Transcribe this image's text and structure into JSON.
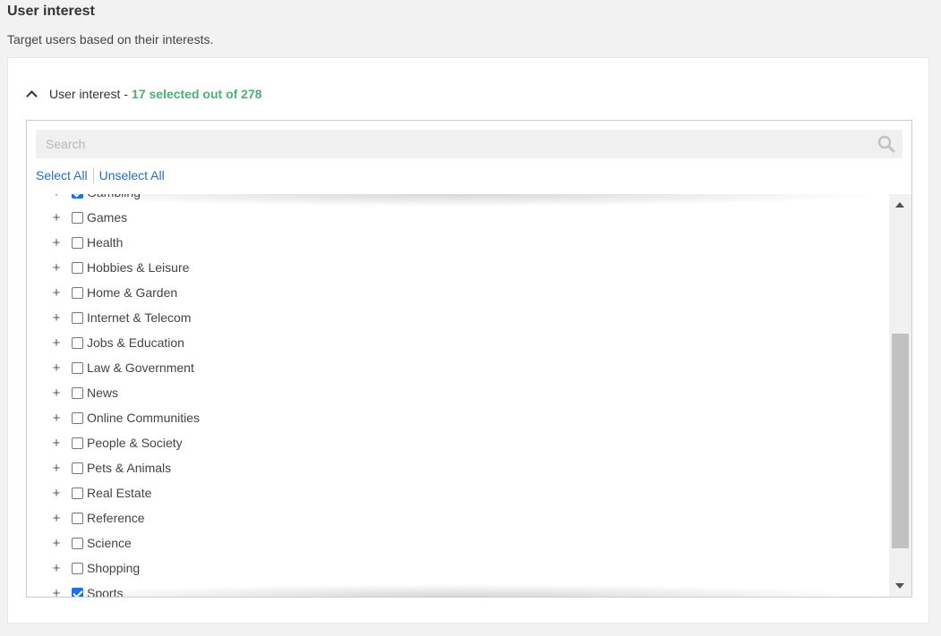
{
  "page": {
    "title": "User interest",
    "subtitle": "Target users based on their interests."
  },
  "section": {
    "label": "User interest",
    "separator": "-",
    "summary": "17 selected out of 278"
  },
  "search": {
    "placeholder": "Search",
    "value": ""
  },
  "actions": {
    "select_all": "Select All",
    "unselect_all": "Unselect All"
  },
  "interests": [
    {
      "label": "Gambling",
      "checked": true
    },
    {
      "label": "Games",
      "checked": false
    },
    {
      "label": "Health",
      "checked": false
    },
    {
      "label": "Hobbies & Leisure",
      "checked": false
    },
    {
      "label": "Home & Garden",
      "checked": false
    },
    {
      "label": "Internet & Telecom",
      "checked": false
    },
    {
      "label": "Jobs & Education",
      "checked": false
    },
    {
      "label": "Law & Government",
      "checked": false
    },
    {
      "label": "News",
      "checked": false
    },
    {
      "label": "Online Communities",
      "checked": false
    },
    {
      "label": "People & Society",
      "checked": false
    },
    {
      "label": "Pets & Animals",
      "checked": false
    },
    {
      "label": "Real Estate",
      "checked": false
    },
    {
      "label": "Reference",
      "checked": false
    },
    {
      "label": "Science",
      "checked": false
    },
    {
      "label": "Shopping",
      "checked": false
    },
    {
      "label": "Sports",
      "checked": true
    }
  ],
  "expander_symbol": "+",
  "icons": {
    "collapse": "chevron-up-icon",
    "search": "search-icon",
    "scroll_up": "arrow-up-icon",
    "scroll_down": "arrow-down-icon"
  },
  "colors": {
    "summary": "#4caf75",
    "link": "#2a6db5",
    "checkbox_checked": "#1a73e8"
  }
}
